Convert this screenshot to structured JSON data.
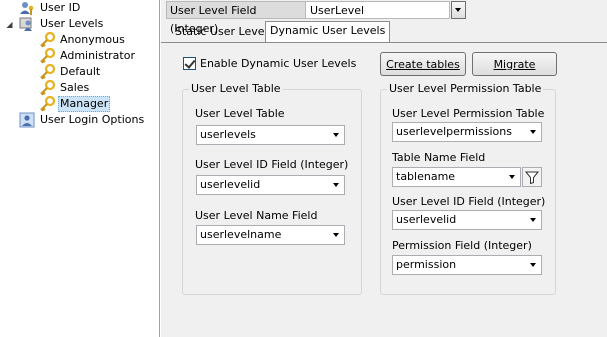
{
  "tree": {
    "items": [
      {
        "label": "User ID",
        "icon": "user-key-icon"
      },
      {
        "label": "User Levels",
        "icon": "user-levels-icon"
      },
      {
        "label": "Anonymous",
        "icon": "key-icon"
      },
      {
        "label": "Administrator",
        "icon": "key-icon"
      },
      {
        "label": "Default",
        "icon": "key-icon"
      },
      {
        "label": "Sales",
        "icon": "key-icon"
      },
      {
        "label": "Manager",
        "icon": "key-icon"
      },
      {
        "label": "User Login Options",
        "icon": "user-login-icon"
      }
    ],
    "expander": "◢"
  },
  "topbar": {
    "property": "User Level Field (Integer)",
    "value": "UserLevel"
  },
  "tabs": [
    "Static User Levels",
    "Dynamic User Levels"
  ],
  "enable_dynamic": {
    "label": "Enable Dynamic User Levels",
    "checked": true
  },
  "buttons": {
    "create_tables": "Create tables",
    "migrate": "Migrate"
  },
  "user_level_table": {
    "legend": "User Level Table",
    "fields": [
      {
        "label": "User Level Table",
        "value": "userlevels"
      },
      {
        "label": "User Level ID Field (Integer)",
        "value": "userlevelid"
      },
      {
        "label": "User Level Name Field",
        "value": "userlevelname"
      }
    ]
  },
  "permission_table": {
    "legend": "User Level Permission Table",
    "fields": [
      {
        "label": "User Level Permission Table",
        "value": "userlevelpermissions"
      },
      {
        "label": "Table Name Field",
        "value": "tablename"
      },
      {
        "label": "User Level ID Field (Integer)",
        "value": "userlevelid"
      },
      {
        "label": "Permission Field (Integer)",
        "value": "permission"
      }
    ]
  },
  "colors": {
    "panel_bg": "#f0f0f0",
    "selection": "#cce4f7",
    "key_gold": "#e8b21f"
  }
}
